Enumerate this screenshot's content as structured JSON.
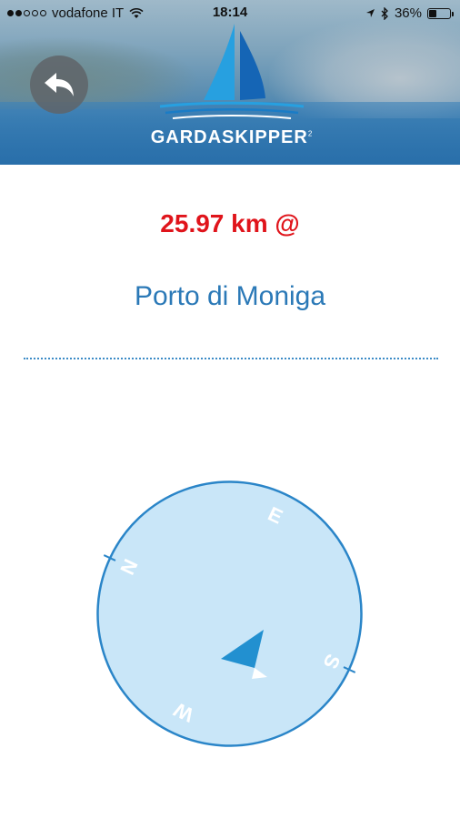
{
  "status_bar": {
    "carrier": "vodafone IT",
    "time": "18:14",
    "battery": "36%",
    "battery_level": 0.36,
    "signal_bars_filled": 2,
    "signal_bars_total": 5
  },
  "header": {
    "brand": "GARDASKIPPER",
    "brand_superscript": "2",
    "back_icon": "reply-arrow-icon"
  },
  "navigation": {
    "distance": "25.97 km @",
    "destination": "Porto di Moniga"
  },
  "compass": {
    "labels": {
      "N": "N",
      "E": "E",
      "S": "S",
      "W": "W"
    },
    "colors": {
      "fill": "#c9e6f8",
      "ring": "#2a85c8",
      "arrow": "#2290d0"
    }
  },
  "colors": {
    "distance": "#e0141b",
    "destination": "#2b79b7",
    "divider": "#3d8cc7"
  }
}
